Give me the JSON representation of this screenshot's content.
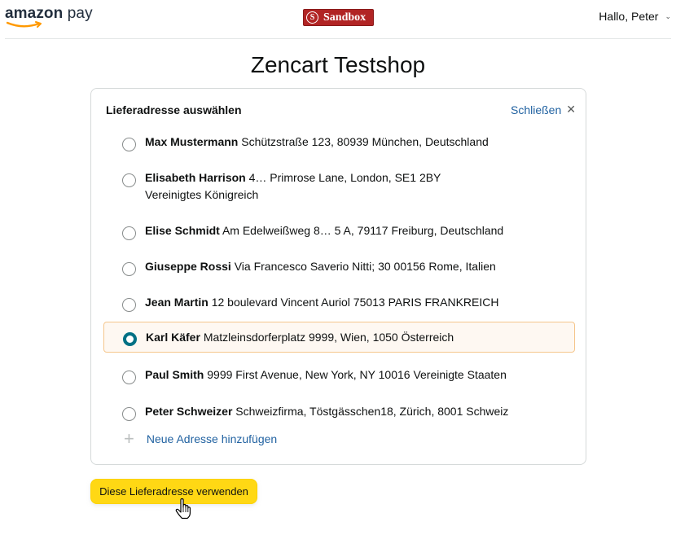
{
  "header": {
    "logo_text_a": "amazon",
    "logo_text_b": "pay",
    "sandbox_icon": "S",
    "sandbox_label": "Sandbox",
    "greeting": "Hallo, Peter",
    "greeting_chevron": "⌄"
  },
  "shop": {
    "title": "Zencart Testshop"
  },
  "panel": {
    "title": "Lieferadresse auswählen",
    "close_label": "Schließen",
    "close_icon": "✕",
    "addresses": [
      {
        "name": "Max Mustermann",
        "address": "Schützstraße 123, 80939 München, Deutschland",
        "selected": false
      },
      {
        "name": "Elisabeth Harrison",
        "address": "4… Primrose Lane, London, SE1 2BY",
        "address2": "Vereinigtes Königreich",
        "selected": false
      },
      {
        "name": "Elise Schmidt",
        "address": "Am Edelweißweg 8… 5 A, 79117 Freiburg, Deutschland",
        "selected": false
      },
      {
        "name": "Giuseppe Rossi",
        "address": "Via Francesco Saverio Nitti; 30 00156 Rome, Italien",
        "selected": false
      },
      {
        "name": "Jean Martin",
        "address": "12 boulevard Vincent Auriol 75013 PARIS FRANKREICH",
        "selected": false
      },
      {
        "name": "Karl Käfer",
        "address": "Matzleinsdorferplatz 9999, Wien, 1050 Österreich",
        "selected": true
      },
      {
        "name": "Paul Smith",
        "address": "9999 First Avenue, New York, NY 10016 Vereinigte Staaten",
        "selected": false
      },
      {
        "name": "Peter Schweizer",
        "address": "Schweizfirma, Töstgässchen18, Zürich, 8001 Schweiz",
        "selected": false
      }
    ],
    "add_new_icon": "+",
    "add_new_label": "Neue Adresse hinzufügen"
  },
  "actions": {
    "use_address_label": "Diese Lieferadresse verwenden"
  },
  "colors": {
    "accent": "#007185",
    "link": "#2162a1",
    "button": "#ffd814",
    "sandbox": "#b12424"
  }
}
